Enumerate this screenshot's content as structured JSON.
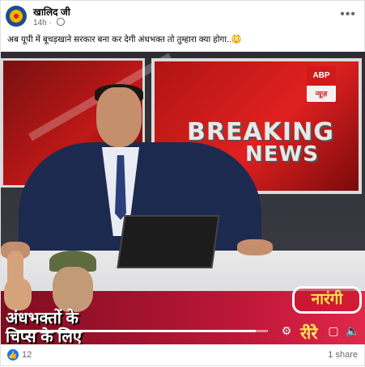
{
  "post": {
    "author": "खालिद जी",
    "time": "14h",
    "caption": "अब यूपी में बूचड़खाने सरकार बना कर देगी अंधभक्त तो तुम्हारा क्या होगा..😳"
  },
  "video": {
    "breaking": "BREAKING",
    "news": "NEWS",
    "channel_logo_top": "ABP",
    "channel_logo_bottom": "न्यूज़",
    "overlay_line1": "अंधभक्तों के",
    "overlay_line2": "चिप्स के लिए",
    "sticker_text": "नारंगी",
    "sticker_sub": "रीरे",
    "progress_fraction": 0.95
  },
  "footer": {
    "like_count": "12",
    "share_text": "1 share"
  },
  "icons": [
    "avatar",
    "globe-icon",
    "more-icon",
    "settings-icon",
    "fullscreen-icon",
    "volume-icon",
    "like-icon"
  ]
}
